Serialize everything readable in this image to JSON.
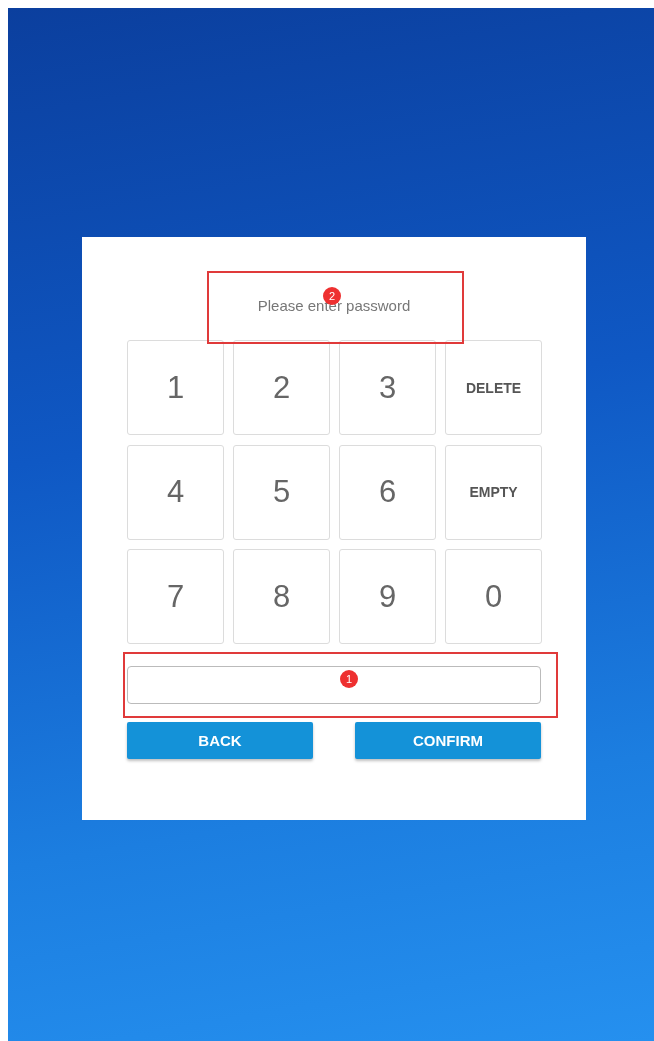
{
  "prompt": {
    "text": "Please enter password",
    "callout": "2"
  },
  "keys": [
    {
      "label": "1",
      "kind": "digit"
    },
    {
      "label": "2",
      "kind": "digit"
    },
    {
      "label": "3",
      "kind": "digit"
    },
    {
      "label": "DELETE",
      "kind": "action"
    },
    {
      "label": "4",
      "kind": "digit"
    },
    {
      "label": "5",
      "kind": "digit"
    },
    {
      "label": "6",
      "kind": "digit"
    },
    {
      "label": "EMPTY",
      "kind": "action"
    },
    {
      "label": "7",
      "kind": "digit"
    },
    {
      "label": "8",
      "kind": "digit"
    },
    {
      "label": "9",
      "kind": "digit"
    },
    {
      "label": "0",
      "kind": "digit"
    }
  ],
  "password_field": {
    "callout": "1"
  },
  "buttons": [
    {
      "label": "BACK"
    },
    {
      "label": "CONFIRM"
    }
  ]
}
